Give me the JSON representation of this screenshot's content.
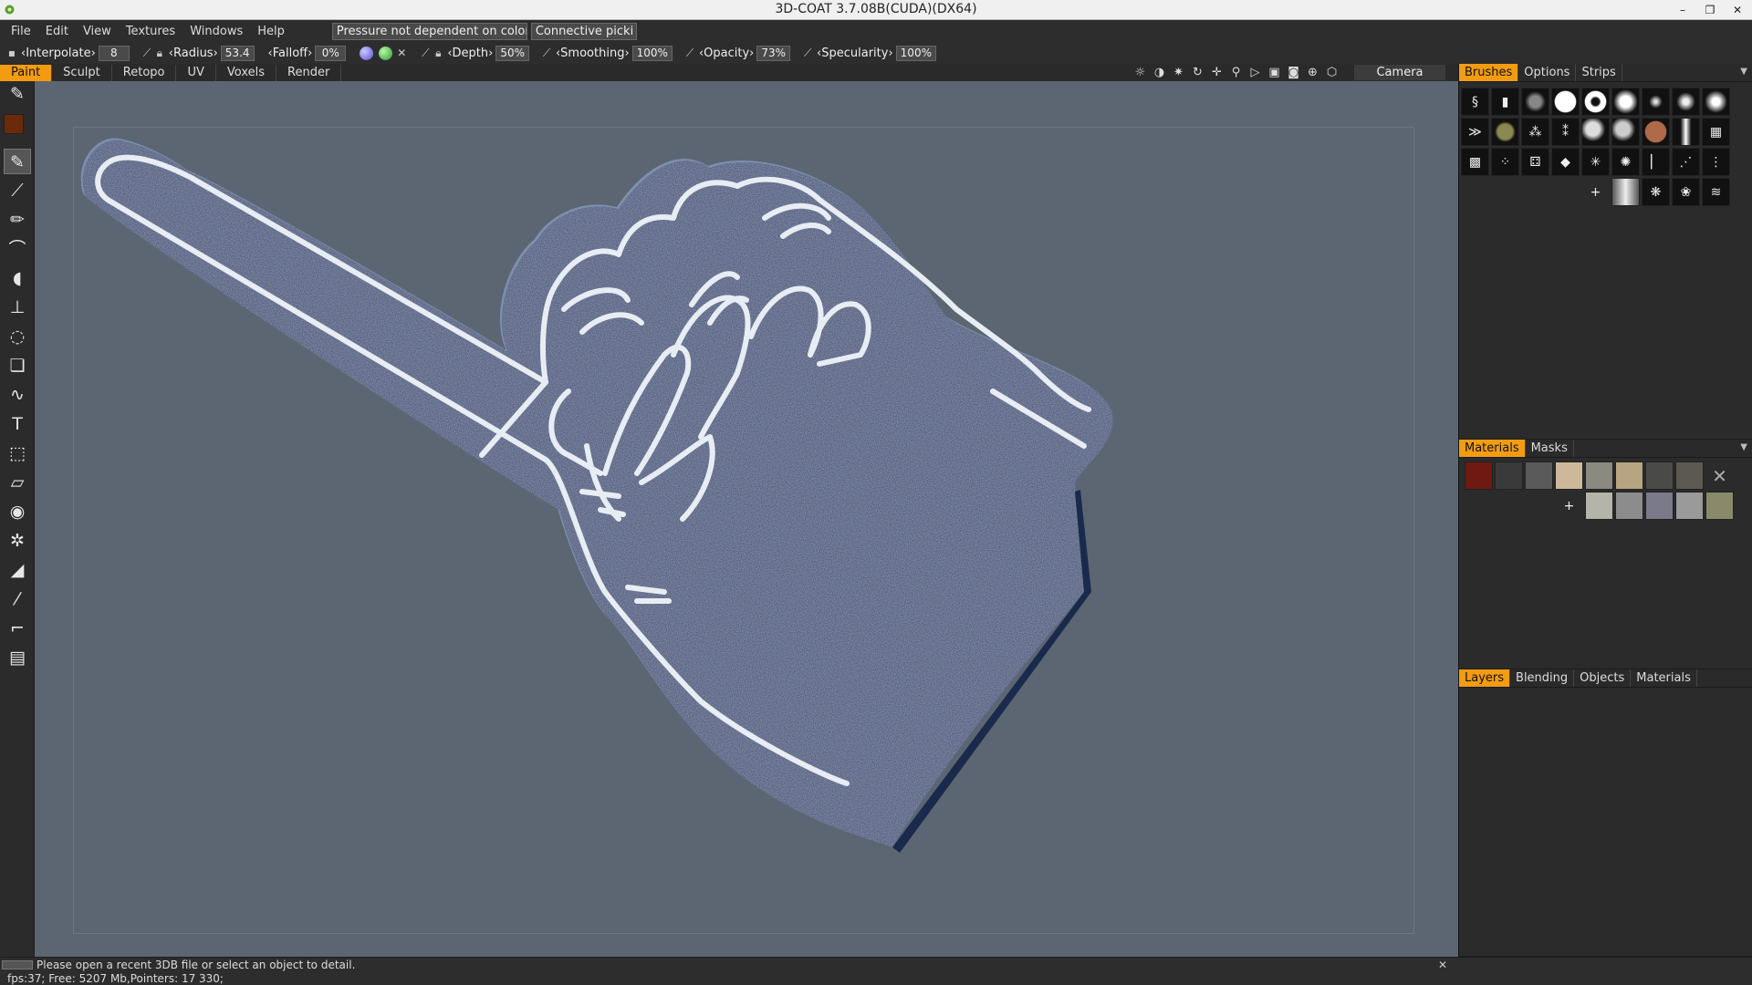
{
  "window": {
    "title": "3D-COAT 3.7.08B(CUDA)(DX64)",
    "controls": [
      "–",
      "❐",
      "✕"
    ]
  },
  "menu": {
    "items": [
      "File",
      "Edit",
      "View",
      "Textures",
      "Windows",
      "Help"
    ],
    "pressure_mode": "Pressure not dependent on color",
    "picking_mode": "Connective picki"
  },
  "params": {
    "interpolate_label": "‹Interpolate›",
    "interpolate_value": "8",
    "radius_label": "‹Radius›",
    "radius_value": "53.4",
    "falloff_label": "‹Falloff›",
    "falloff_value": "0%",
    "depth_label": "‹Depth›",
    "depth_value": "50%",
    "smoothing_label": "‹Smoothing›",
    "smoothing_value": "100%",
    "opacity_label": "‹Opacity›",
    "opacity_value": "73%",
    "specularity_label": "‹Specularity›",
    "specularity_value": "100%"
  },
  "rooms": {
    "tabs": [
      "Paint",
      "Sculpt",
      "Retopo",
      "UV",
      "Voxels",
      "Render"
    ],
    "active": "Paint",
    "camera_label": "Camera"
  },
  "view_icons": [
    "sun-icon",
    "contrast-icon",
    "light-icon",
    "rotate-icon",
    "move-icon",
    "zoom-icon",
    "play-icon",
    "square-view-icon",
    "frame-icon",
    "target-icon",
    "cube-icon"
  ],
  "tools": [
    "brush-icon",
    "color-swatch",
    "paint-brush-icon",
    "airbrush-icon",
    "pencil-icon",
    "smudge-icon",
    "fill-icon",
    "stamp-icon",
    "lasso-icon",
    "copy-icon",
    "curve-icon",
    "text-icon",
    "transform-icon",
    "eraser-icon",
    "eye-icon",
    "gear-icon",
    "bucket-icon",
    "picker-icon",
    "iron-icon",
    "ruler-icon"
  ],
  "brushes_panel": {
    "tabs": [
      "Brushes",
      "Options",
      "Strips"
    ],
    "active": "Brushes",
    "add_label": "+"
  },
  "materials_panel": {
    "tabs": [
      "Materials",
      "Masks"
    ],
    "active": "Materials",
    "add_label": "+",
    "clear_label": "✕"
  },
  "layers_panel": {
    "tabs": [
      "Layers",
      "Blending",
      "Objects",
      "Materials"
    ],
    "active": "Layers"
  },
  "status": {
    "message": "Please open a recent 3DB file or select an object to detail.",
    "stats": "fps:37;    Free: 5207 Mb,Pointers: 17 330;",
    "close": "✕"
  },
  "colors": {
    "accent": "#f39c12",
    "viewport_bg": "#5c6673",
    "foam_finger": "#263c6a",
    "primary_color": "#6b2a0a"
  }
}
